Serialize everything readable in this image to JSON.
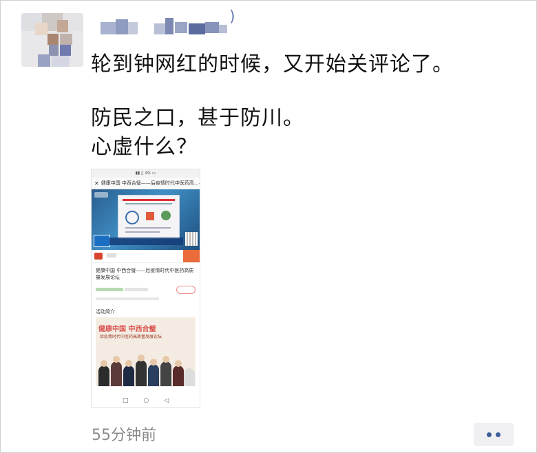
{
  "post": {
    "line1": "轮到钟网红的时候，又开始关评论了。",
    "line2": "防民之口，甚于防川。",
    "line3": "心虚什么？"
  },
  "nickname_suffix": ")",
  "timestamp": "55分钟前",
  "icons": {
    "avatar": "blurred-avatar",
    "more": "more-dots-icon",
    "close": "close-icon"
  },
  "embedded": {
    "nav_title": "健康中国 中西合璧——后疫情时代中医药高...",
    "article_title": "健康中国 中西合璧——后疫情时代中医药高质量发展论坛",
    "section_label": "活动简介",
    "poster_title": "健康中国  中西合璧",
    "poster_subtitle": "后疫情时代中医药高质量发展论坛",
    "nav_keys": [
      "□",
      "○",
      "◁"
    ]
  },
  "colors": {
    "link_blue": "#3c5f99",
    "time_gray": "#8a8a8a",
    "poster_red": "#d9534f"
  }
}
